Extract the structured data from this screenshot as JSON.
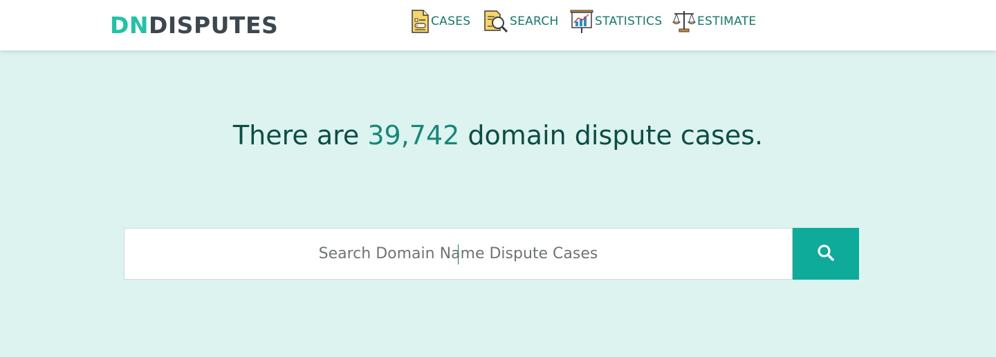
{
  "header": {
    "logo": {
      "part1": "DN",
      "part2": "DISPUTES"
    },
    "nav": [
      {
        "label": "CASES",
        "icon": "document-icon"
      },
      {
        "label": "SEARCH",
        "icon": "magnifier-document-icon"
      },
      {
        "label": "STATISTICS",
        "icon": "presentation-chart-icon"
      },
      {
        "label": "ESTIMATE",
        "icon": "scales-icon"
      }
    ]
  },
  "hero": {
    "prefix": "There are ",
    "count": "39,742",
    "suffix": " domain dispute cases."
  },
  "search": {
    "placeholder": "Search Domain Name Dispute Cases",
    "button_icon": "search-icon"
  },
  "colors": {
    "background": "#dcf3f0",
    "accent": "#0eaa9a",
    "logo_dn": "#1fc3a5",
    "logo_disputes": "#3c4850",
    "nav_text": "#137a6e",
    "title_text": "#0c4d44"
  }
}
